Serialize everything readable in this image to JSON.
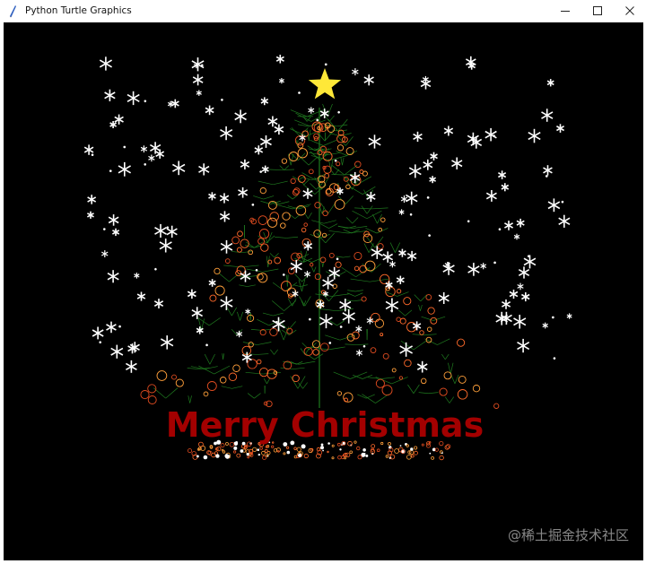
{
  "window": {
    "title": "Python Turtle Graphics",
    "icons": {
      "app": "turtle-feather-icon",
      "minimize": "minimize-icon",
      "maximize": "maximize-icon",
      "close": "close-icon"
    }
  },
  "canvas": {
    "background_color": "#000000",
    "greeting_text": "Merry Christmas",
    "greeting_color": "#a30000",
    "star_color": "#ffe838",
    "snow_color": "#ffffff",
    "tree_color": "#1f7a1f",
    "ornament_colors": [
      "#ff6a2a",
      "#ff9f3a",
      "#e04c20"
    ]
  },
  "watermark": {
    "text": "@稀土掘金技术社区"
  }
}
